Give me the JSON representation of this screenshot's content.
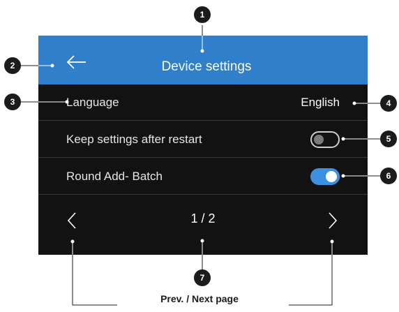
{
  "header": {
    "title": "Device settings",
    "back_icon": "arrow-left-icon"
  },
  "settings": [
    {
      "label": "Language",
      "value": "English"
    },
    {
      "label": "Keep settings after restart",
      "toggle": "off"
    },
    {
      "label": "Round Add- Batch",
      "toggle": "on"
    }
  ],
  "pager": {
    "current": "1 / 2",
    "prev_icon": "chevron-left-icon",
    "next_icon": "chevron-right-icon"
  },
  "callouts": [
    "1",
    "2",
    "3",
    "4",
    "5",
    "6",
    "7"
  ],
  "caption": "Prev. / Next page",
  "colors": {
    "header_bg": "#2f7fca",
    "screen_bg": "#121212",
    "toggle_on": "#3d8fe0",
    "callout_bg": "#1b1b1b"
  }
}
